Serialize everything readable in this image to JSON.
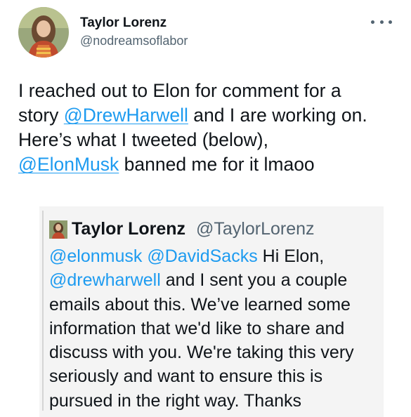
{
  "author": {
    "display_name": "Taylor Lorenz",
    "handle": "@nodreamsoflabor"
  },
  "menu": {
    "icon": "more-horizontal-icon"
  },
  "tweet": {
    "line1": "I reached out to Elon for comment for a",
    "line2_prefix": "story ",
    "line2_mention": "@DrewHarwell",
    "line2_suffix": " and I are working on.",
    "line3": "Here’s what I tweeted (below),",
    "line4_mention": "@ElonMusk",
    "line4_suffix": " banned me for it lmaoo"
  },
  "quoted": {
    "display_name": "Taylor Lorenz",
    "handle": "@TaylorLorenz",
    "line1_mention1": "@elonmusk",
    "line1_mention2": "@DavidSacks",
    "line1_suffix": " Hi Elon,",
    "line2_mention": "@drewharwell",
    "line2_suffix": " and I sent you a couple",
    "line3": "emails about this. We’ve learned some",
    "line4": "information that we'd like to share and",
    "line5": "discuss with you. We're taking this very",
    "line6": "seriously and want to ensure this is",
    "line7": "pursued in the right way. Thanks"
  },
  "colors": {
    "link": "#1d9bf0",
    "secondary_text": "#536471",
    "quote_background": "#f4f4f4"
  }
}
